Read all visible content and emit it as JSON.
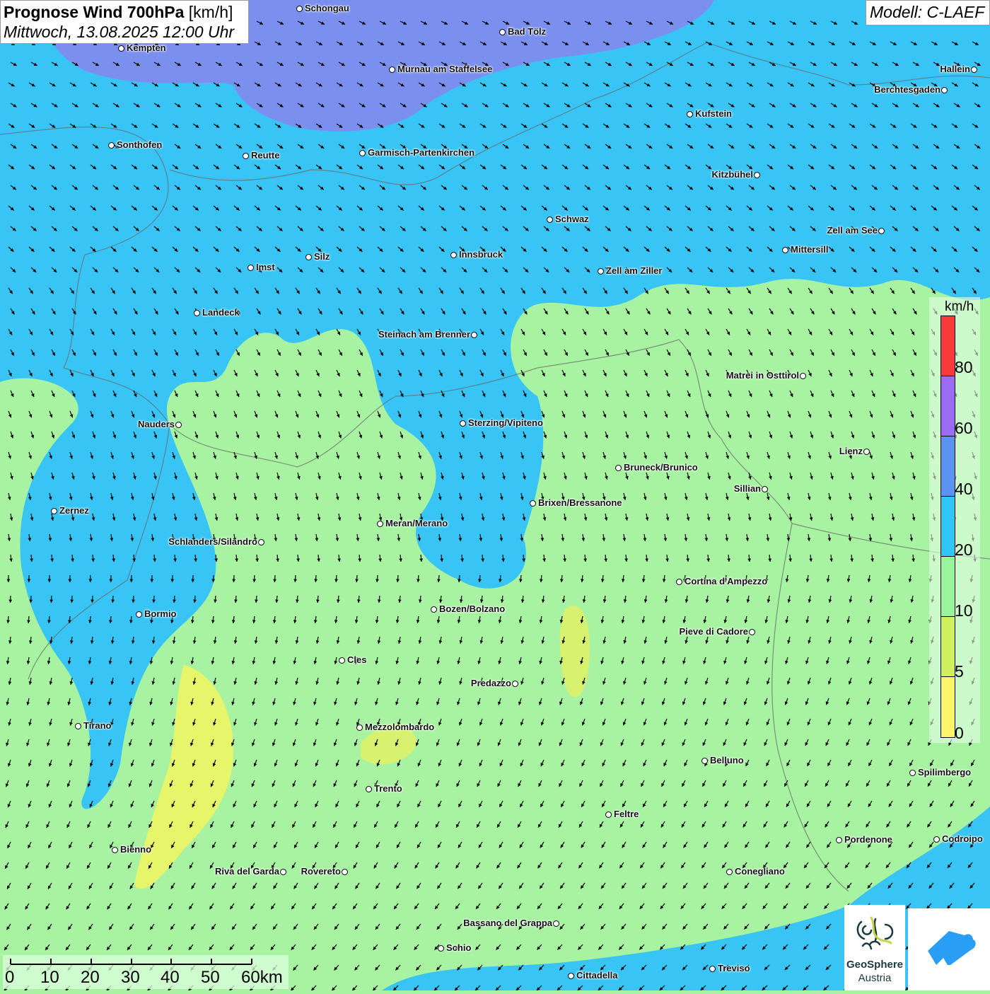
{
  "header": {
    "title_bold": "Prognose Wind 700hPa",
    "title_unit": "[km/h]",
    "datetime": "Mittwoch, 13.08.2025 12:00 Uhr"
  },
  "model": "Modell: C-LAEF",
  "legend": {
    "unit": "km/h",
    "labels": [
      "80",
      "60",
      "40",
      "20",
      "10",
      "5",
      "0"
    ],
    "colors": [
      "#f93a3a",
      "#9a6cf3",
      "#5b93f0",
      "#30c6f8",
      "#98f59a",
      "#cdf05c",
      "#fdf66a"
    ]
  },
  "scale_bar": {
    "labels": [
      "0",
      "10",
      "20",
      "30",
      "40",
      "50",
      "60km"
    ]
  },
  "logos": {
    "geosphere_line1": "GeoSphere",
    "geosphere_line2": "Austria"
  },
  "cities": [
    "Schongau",
    "Bad Tölz",
    "Kempten",
    "Murnau am Staffelsee",
    "Hallein",
    "Berchtesgaden",
    "Kufstein",
    "Sonthofen",
    "Reutte",
    "Garmisch-Partenkirchen",
    "Kitzbühel",
    "Schwaz",
    "Zell am See",
    "Mittersill",
    "Innsbruck",
    "Silz",
    "Imst",
    "Zell am Ziller",
    "Landeck",
    "Steinach am Brenner",
    "Matrei in Osttirol",
    "Nauders",
    "Sterzing/Vipiteno",
    "Lienz",
    "Bruneck/Brunico",
    "Sillian",
    "Brixen/Bressanone",
    "Zernez",
    "Meran/Merano",
    "Schlanders/Silandro",
    "Cortina d'Ampezzo",
    "Bormio",
    "Bozen/Bolzano",
    "Pieve di Cadore",
    "Cles",
    "Predazzo",
    "Tirano",
    "Mezzolombardo",
    "Belluno",
    "Spilimbergo",
    "Trento",
    "Feltre",
    "Bienno",
    "Pordenone",
    "Codroipo",
    "Riva del Garda",
    "Rovereto",
    "Conegliano",
    "Bassano del Grappa",
    "Schio",
    "Treviso",
    "Cittadella"
  ]
}
